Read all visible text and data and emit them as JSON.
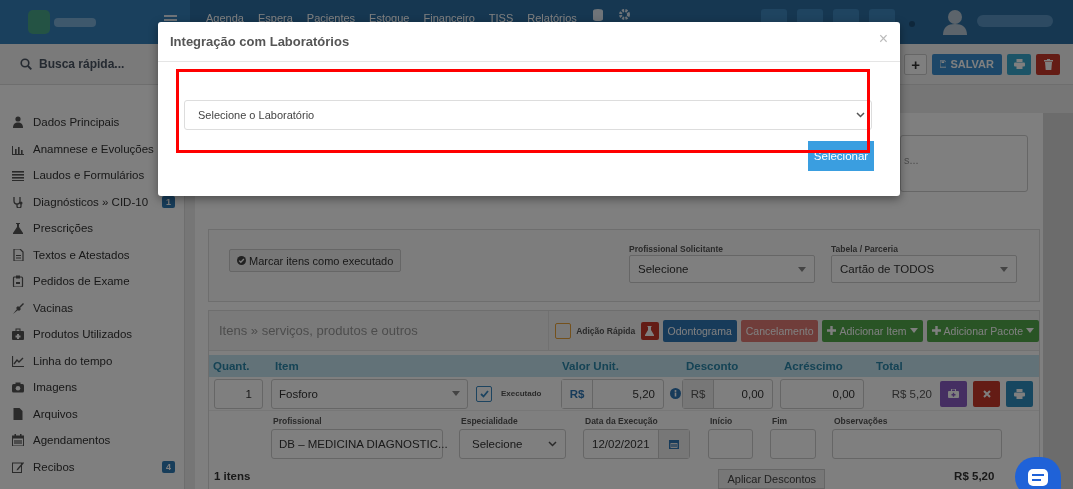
{
  "header": {
    "nav": [
      "Agenda",
      "Espera",
      "Pacientes",
      "Estoque",
      "Financeiro",
      "TISS",
      "Relatórios"
    ]
  },
  "search": {
    "placeholder": "Busca rápida..."
  },
  "toolbar": {
    "buttons": [
      {
        "kind": "add",
        "label": "+"
      },
      {
        "kind": "save",
        "label": "SALVAR"
      },
      {
        "kind": "print"
      },
      {
        "kind": "delete"
      }
    ]
  },
  "sidebar": {
    "items": [
      {
        "label": "Dados Principais"
      },
      {
        "label": "Anamnese e Evoluções"
      },
      {
        "label": "Laudos e Formulários"
      },
      {
        "label": "Diagnósticos » CID-10",
        "badge": "1"
      },
      {
        "label": "Prescrições"
      },
      {
        "label": "Textos e Atestados"
      },
      {
        "label": "Pedidos de Exame"
      },
      {
        "label": "Vacinas"
      },
      {
        "label": "Produtos Utilizados"
      },
      {
        "label": "Linha do tempo"
      },
      {
        "label": "Imagens"
      },
      {
        "label": "Arquivos"
      },
      {
        "label": "Agendamentos"
      },
      {
        "label": "Recibos",
        "badge": "4"
      }
    ]
  },
  "notes": {
    "placeholder": "s..."
  },
  "request": {
    "mark_button": "Marcar itens como executado",
    "fields": [
      {
        "label": "Profissional Solicitante",
        "value": "Selecione"
      },
      {
        "label": "Tabela / Parceria",
        "value": "Cartão de TODOS"
      }
    ]
  },
  "items_panel": {
    "title": "Itens » serviços, produtos e outros",
    "quick_add": {
      "label": "Adição Rápida",
      "checked": false
    },
    "buttons": [
      {
        "kind": "lab"
      },
      {
        "kind": "primary",
        "label": "Odontograma"
      },
      {
        "kind": "cancel",
        "label": "Cancelamento"
      },
      {
        "kind": "add",
        "label": "Adicionar Item"
      },
      {
        "kind": "add",
        "label": "Adicionar Pacote"
      }
    ],
    "columns": [
      "Quant.",
      "Item",
      "Valor Unit.",
      "Desconto",
      "Acréscimo",
      "Total"
    ],
    "rows": [
      {
        "quantity": "1",
        "item": "Fosforo",
        "executed": true,
        "executed_label": "Executado",
        "unit_currency": "R$",
        "unit_value": "5,20",
        "discount_currency": "R$",
        "discount": "0,00",
        "surcharge": "0,00",
        "total": "R$ 5,20",
        "professional_label": "Profissional",
        "professional": "DB – MEDICINA DIAGNOSTIC...",
        "specialty_label": "Especialidade",
        "specialty": "Selecione",
        "date_label": "Data da Execução",
        "date": "12/02/2021",
        "start_label": "Início",
        "end_label": "Fim",
        "notes_label": "Observações"
      }
    ],
    "footer": {
      "count": "1 itens",
      "discount_button": "Aplicar Descontos",
      "total": "R$ 5,20"
    }
  },
  "modal": {
    "title": "Integração com Laboratórios",
    "close": "×",
    "select_placeholder": "Selecione o Laboratório",
    "button": "Selecionar",
    "highlighted": true
  }
}
